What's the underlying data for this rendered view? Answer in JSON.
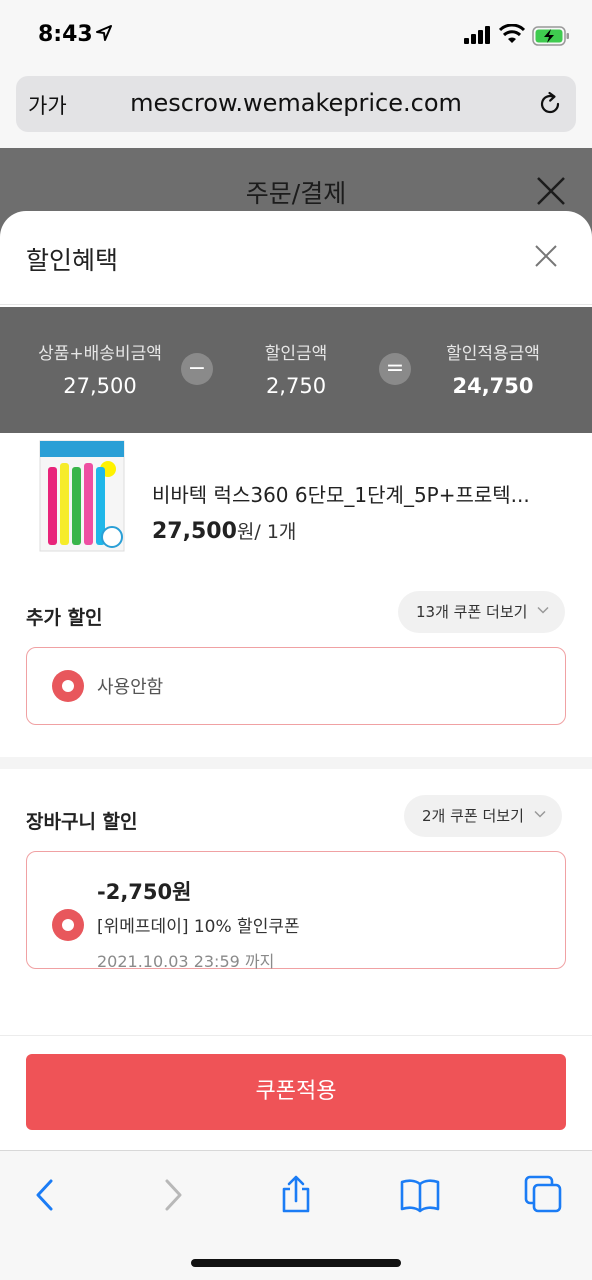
{
  "status_bar": {
    "time": "8:43"
  },
  "browser": {
    "text_size_label": "가가",
    "url": "mescrow.wemakeprice.com"
  },
  "underlay": {
    "title": "주문/결제"
  },
  "sheet": {
    "title": "할인혜택",
    "summary": {
      "items": [
        {
          "label": "상품+배송비금액",
          "value": "27,500"
        },
        {
          "label": "할인금액",
          "value": "2,750"
        },
        {
          "label": "할인적용금액",
          "value": "24,750"
        }
      ],
      "minus_op": "−",
      "equals_op": "="
    },
    "product": {
      "name": "비바텍 럭스360 6단모_1단계_5P+프로텍...",
      "price": "27,500",
      "price_suffix": "원/ 1개"
    },
    "additional_discount": {
      "label": "추가 할인",
      "more_label": "13개 쿠폰 더보기",
      "selected_option": "사용안함"
    },
    "cart_discount": {
      "label": "장바구니 할인",
      "more_label": "2개 쿠폰 더보기",
      "coupon": {
        "amount": "-2,750원",
        "name": "[위메프데이] 10% 할인쿠폰",
        "expiry": "2021.10.03 23:59 까지"
      }
    },
    "apply_button": "쿠폰적용"
  },
  "colors": {
    "accent": "#ef5357",
    "radio": "#e8575c",
    "card_border": "#f0a1a3",
    "summary_bg": "#666666",
    "ios_blue": "#1b7cf5"
  },
  "icons": {
    "status": [
      "location-arrow-icon",
      "cellular-signal-icon",
      "wifi-icon",
      "battery-charging-icon"
    ],
    "toolbar": [
      "back-icon",
      "forward-icon",
      "share-icon",
      "bookmarks-icon",
      "tabs-icon"
    ]
  }
}
